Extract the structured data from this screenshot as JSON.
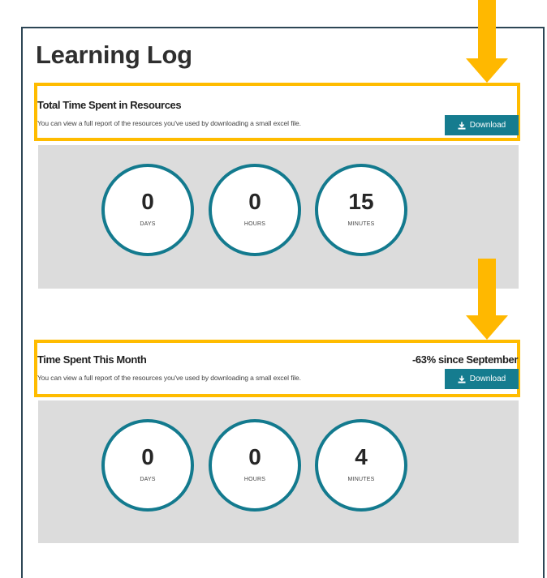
{
  "page": {
    "title": "Learning Log"
  },
  "sections": [
    {
      "heading": "Total Time Spent in Resources",
      "description": "You can view a full report of the resources you've used by downloading a small excel file.",
      "download_label": "Download",
      "change_text": "",
      "stats": [
        {
          "value": "0",
          "label": "DAYS"
        },
        {
          "value": "0",
          "label": "HOURS"
        },
        {
          "value": "15",
          "label": "MINUTES"
        }
      ]
    },
    {
      "heading": "Time Spent This Month",
      "description": "You can view a full report of the resources you've used by downloading a small excel file.",
      "download_label": "Download",
      "change_text": "-63% since September",
      "stats": [
        {
          "value": "0",
          "label": "DAYS"
        },
        {
          "value": "0",
          "label": "HOURS"
        },
        {
          "value": "4",
          "label": "MINUTES"
        }
      ]
    }
  ],
  "colors": {
    "accent": "#157c8f",
    "circle_border": "#137a8e",
    "annotation": "#ffb800",
    "panel_background": "#dcdcdc",
    "frame_border": "#2d4655"
  }
}
